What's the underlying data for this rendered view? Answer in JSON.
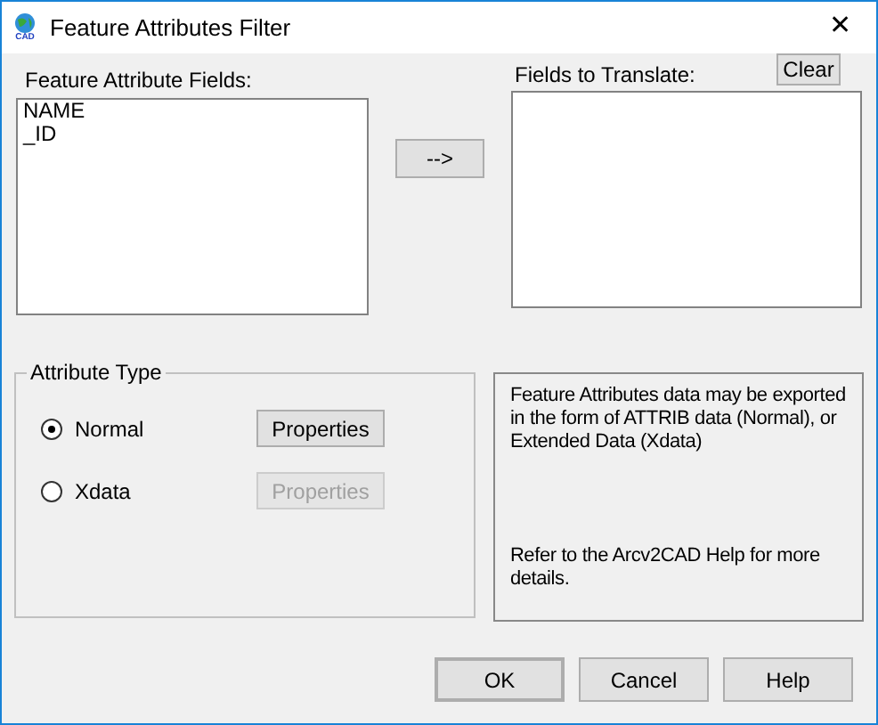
{
  "window": {
    "title": "Feature Attributes Filter",
    "icon_label": "CAD",
    "close": "✕"
  },
  "source_list": {
    "label": "Feature Attribute Fields:",
    "items": [
      "NAME",
      "_ID"
    ]
  },
  "move_button": "-->",
  "target_list": {
    "label": "Fields to Translate:",
    "clear_button": "Clear"
  },
  "attribute_type": {
    "title": "Attribute Type",
    "options": [
      {
        "label": "Normal",
        "selected": true,
        "button": "Properties",
        "disabled": false
      },
      {
        "label": "Xdata",
        "selected": false,
        "button": "Properties",
        "disabled": true
      }
    ]
  },
  "info": [
    "Feature Attributes data may be exported in the form of ATTRIB data (Normal), or Extended Data (Xdata)",
    "Refer to the Arcv2CAD Help for more details."
  ],
  "buttons": [
    "OK",
    "Cancel",
    "Help"
  ]
}
